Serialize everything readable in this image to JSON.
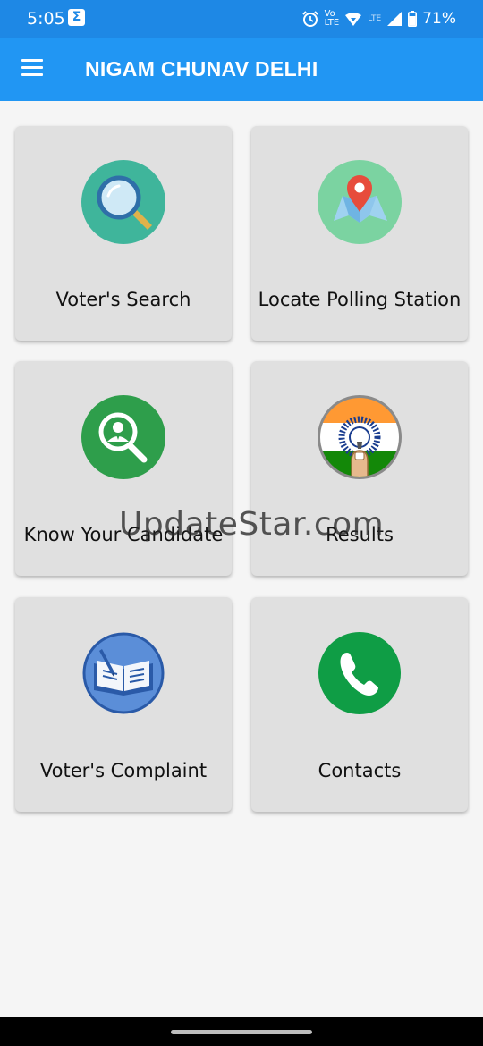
{
  "status_bar": {
    "time": "5:05",
    "notification_icon": "sigma-icon",
    "volte_label": "VoLTE",
    "lte_label": "LTE",
    "battery": "71%"
  },
  "app_bar": {
    "title": "NIGAM CHUNAV DELHI",
    "menu_icon": "hamburger-menu-icon"
  },
  "menu_items": [
    {
      "label": "Voter's Search",
      "icon": "magnifier-icon",
      "color": "#3fb59b"
    },
    {
      "label": "Locate Polling Station",
      "icon": "map-pin-icon",
      "color": "#7bd3a1"
    },
    {
      "label": "Know Your Candidate",
      "icon": "candidate-search-icon",
      "color": "#2e9e4b"
    },
    {
      "label": "Results",
      "icon": "indian-flag-vote-icon",
      "color": "#ff9933"
    },
    {
      "label": "Voter's Complaint",
      "icon": "book-pen-icon",
      "color": "#5b8ed8"
    },
    {
      "label": "Contacts",
      "icon": "phone-icon",
      "color": "#0f9d45"
    }
  ],
  "watermark": "UpdateStar.com"
}
